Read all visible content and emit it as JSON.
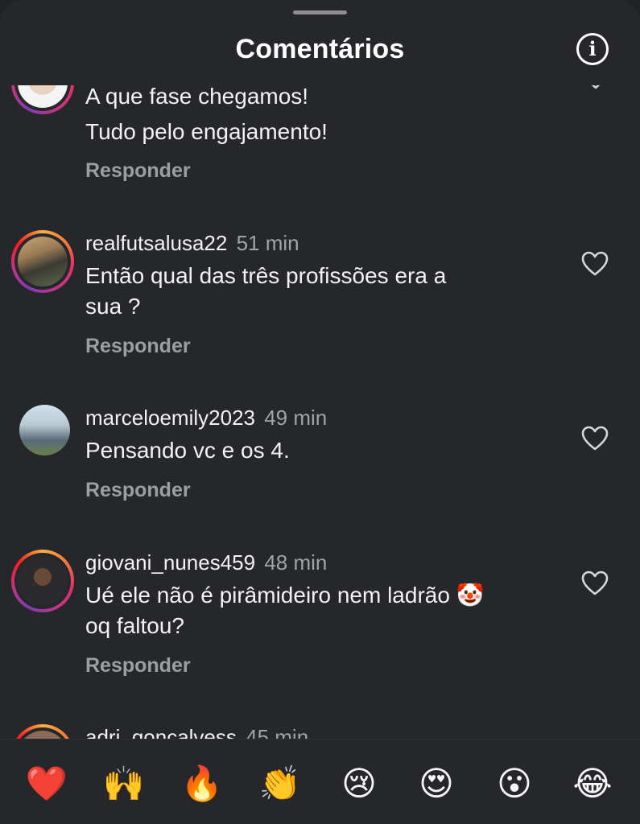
{
  "header": {
    "title": "Comentários",
    "info_icon": "info-circle-icon"
  },
  "comments": [
    {
      "username": "",
      "time": "",
      "text_lines": [
        "A que fase chegamos!",
        "Tudo pelo engajamento!"
      ],
      "reply_label": "Responder"
    },
    {
      "username": "realfutsalusa22",
      "time": "51 min",
      "text_lines": [
        "Então qual das três profissões era a",
        "sua ?"
      ],
      "reply_label": "Responder"
    },
    {
      "username": "marceloemily2023",
      "time": "49 min",
      "text_lines": [
        "Pensando vc e os 4."
      ],
      "reply_label": "Responder"
    },
    {
      "username": "giovani_nunes459",
      "time": "48 min",
      "text_lines": [
        "Ué ele não é pirâmideiro nem ladrão 🤡",
        "oq faltou?"
      ],
      "reply_label": "Responder"
    },
    {
      "username": "adri_goncalvess",
      "time": "45 min",
      "text_lines": [],
      "reply_label": ""
    }
  ],
  "reactions": [
    "❤️",
    "🙌",
    "🔥",
    "👏",
    "😢",
    "😍",
    "😮",
    "😂"
  ],
  "colors": {
    "background": "#25272b",
    "text": "#f2f2f2",
    "muted": "#9b9ea3",
    "story_ring": [
      "#fcaf45",
      "#e1306c",
      "#833ab4"
    ]
  }
}
